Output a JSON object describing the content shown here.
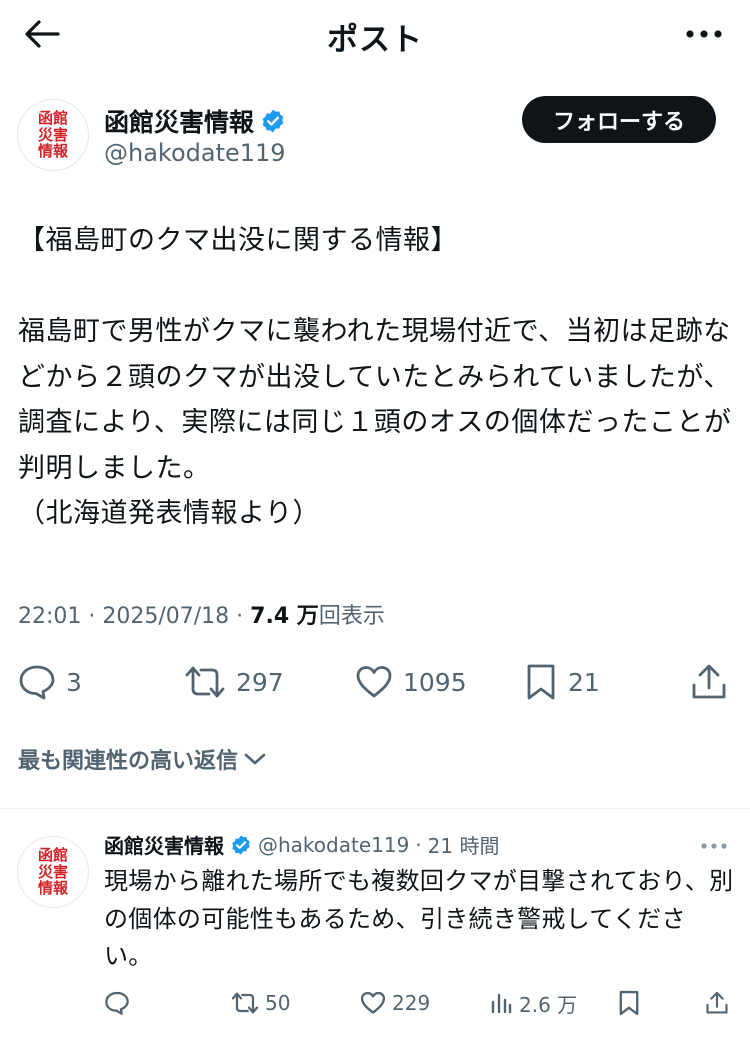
{
  "header": {
    "title": "ポスト",
    "back_icon": "arrow-left-icon",
    "more_icon": "more-horizontal-icon"
  },
  "post": {
    "avatar_lines": [
      "函館",
      "災害",
      "情報"
    ],
    "author_name": "函館災害情報",
    "verified": true,
    "handle": "@hakodate119",
    "follow_label": "フォローする",
    "body": "【福島町のクマ出没に関する情報】\n\n福島町で男性がクマに襲われた現場付近で、当初は足跡などから２頭のクマが出没していたとみられていましたが、調査により、実際には同じ１頭のオスの個体だったことが判明しました。\n（北海道発表情報より）",
    "time": "22:01 · 2025/07/18 · ",
    "views_number": "7.4 万",
    "views_label": "回表示",
    "stats": {
      "replies": "3",
      "reposts": "297",
      "likes": "1095",
      "bookmarks": "21"
    }
  },
  "related_label": "最も関連性の高い返信",
  "reply": {
    "avatar_lines": [
      "函館",
      "災害",
      "情報"
    ],
    "author_name": "函館災害情報",
    "handle": "@hakodate119",
    "time": "21 時間",
    "body": "現場から離れた場所でも複数回クマが目撃されており、別の個体の可能性もあるため、引き続き警戒してください。",
    "stats": {
      "reposts": "50",
      "likes": "229",
      "views": "2.6 万"
    }
  },
  "colors": {
    "text": "#0f1419",
    "secondary": "#536471",
    "verified": "#1d9bf0",
    "avatar_red": "#d2232a",
    "divider": "#eff3f4"
  }
}
